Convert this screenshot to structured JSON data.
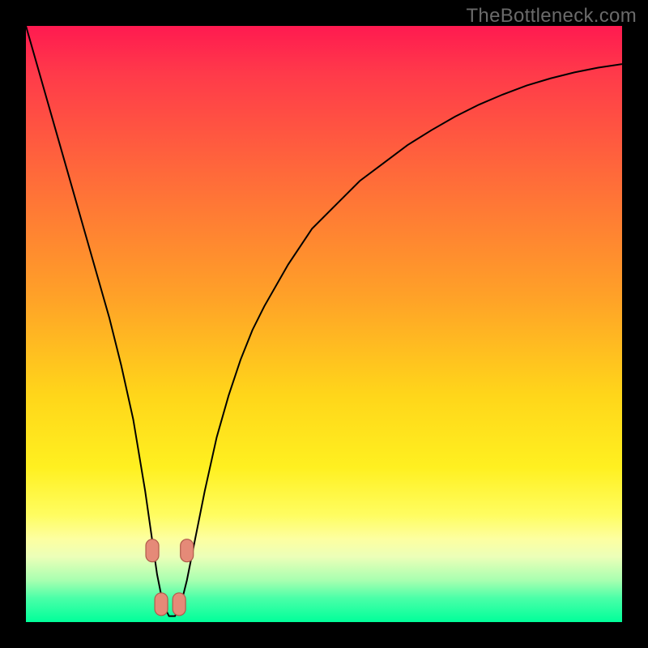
{
  "watermark": "TheBottleneck.com",
  "chart_data": {
    "type": "line",
    "title": "",
    "xlabel": "",
    "ylabel": "",
    "xlim": [
      0,
      100
    ],
    "ylim": [
      0,
      100
    ],
    "series": [
      {
        "name": "bottleneck-curve",
        "x": [
          0,
          2,
          4,
          6,
          8,
          10,
          12,
          14,
          16,
          18,
          20,
          21,
          22,
          23,
          24,
          25,
          26,
          27,
          28,
          30,
          32,
          34,
          36,
          38,
          40,
          44,
          48,
          52,
          56,
          60,
          64,
          68,
          72,
          76,
          80,
          84,
          88,
          92,
          96,
          100
        ],
        "values": [
          100,
          93,
          86,
          79,
          72,
          65,
          58,
          51,
          43,
          34,
          22,
          15,
          8,
          3,
          1,
          1,
          3,
          7,
          12,
          22,
          31,
          38,
          44,
          49,
          53,
          60,
          66,
          70,
          74,
          77,
          80,
          82.5,
          84.8,
          86.8,
          88.5,
          90.0,
          91.2,
          92.2,
          93.0,
          93.6
        ]
      }
    ],
    "markers": [
      {
        "x": 21.2,
        "y": 12
      },
      {
        "x": 22.7,
        "y": 3
      },
      {
        "x": 25.7,
        "y": 3
      },
      {
        "x": 27.0,
        "y": 12
      }
    ],
    "colors": {
      "curve": "#000000",
      "marker_fill": "#e58a78",
      "marker_stroke": "#b05a4a"
    }
  }
}
